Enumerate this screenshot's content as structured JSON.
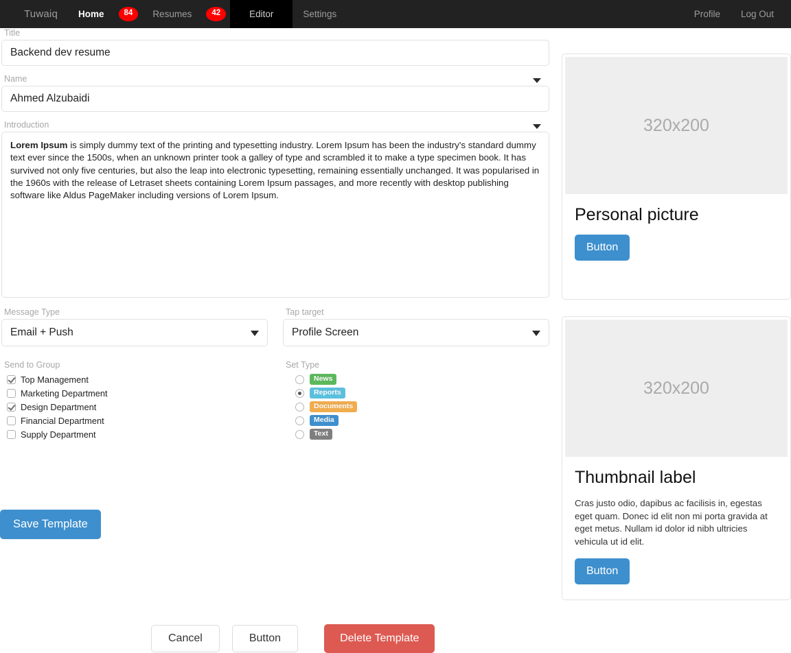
{
  "navbar": {
    "brand": "Tuwaiq",
    "items": [
      {
        "label": "Home",
        "state": "active-home"
      },
      {
        "badge": "84"
      },
      {
        "label": "Resumes",
        "state": "normal"
      },
      {
        "badge": "42"
      },
      {
        "label": "Editor",
        "state": "active-tab"
      },
      {
        "label": "Settings",
        "state": "normal"
      }
    ],
    "right": [
      {
        "label": "Profile"
      },
      {
        "label": "Log Out"
      }
    ]
  },
  "form": {
    "title": {
      "label": "Title",
      "value": "Backend dev resume"
    },
    "name": {
      "label": "Name",
      "value": "Ahmed Alzubaidi"
    },
    "introduction": {
      "label": "Introduction",
      "lead": "Lorem Ipsum",
      "body": " is simply dummy text of the printing and typesetting industry. Lorem Ipsum has been the industry's standard dummy text ever since the 1500s, when an unknown printer took a galley of type and scrambled it to make a type specimen book. It has survived not only five centuries, but also the leap into electronic typesetting, remaining essentially unchanged. It was popularised in the 1960s with the release of Letraset sheets containing Lorem Ipsum passages, and more recently with desktop publishing software like Aldus PageMaker including versions of Lorem Ipsum."
    },
    "message_type": {
      "label": "Message Type",
      "value": "Email + Push"
    },
    "tap_target": {
      "label": "Tap target",
      "value": "Profile Screen"
    },
    "send_to_group": {
      "label": "Send to Group",
      "options": [
        {
          "label": "Top Management",
          "checked": true
        },
        {
          "label": "Marketing Department",
          "checked": false
        },
        {
          "label": "Design Department",
          "checked": true
        },
        {
          "label": "Financial Department",
          "checked": false
        },
        {
          "label": "Supply Department",
          "checked": false
        }
      ]
    },
    "set_type": {
      "label": "Set Type",
      "options": [
        {
          "label": "News",
          "color": "#5cb85c",
          "selected": false
        },
        {
          "label": "Reports",
          "color": "#5bc0de",
          "selected": true
        },
        {
          "label": "Documents",
          "color": "#f0ad4e",
          "selected": false
        },
        {
          "label": "Media",
          "color": "#3e8fcd",
          "selected": false
        },
        {
          "label": "Text",
          "color": "#7f7f7f",
          "selected": false
        }
      ]
    },
    "save_button": "Save Template"
  },
  "footer": {
    "cancel": "Cancel",
    "button": "Button",
    "delete": "Delete Template"
  },
  "cards": [
    {
      "placeholder": "320x200",
      "title": "Personal picture",
      "text": "",
      "button": "Button"
    },
    {
      "placeholder": "320x200",
      "title": "Thumbnail label",
      "text": "Cras justo odio, dapibus ac facilisis in, egestas eget quam. Donec id elit non mi porta gravida at eget metus. Nullam id dolor id nibh ultricies vehicula ut id elit.",
      "button": "Button"
    }
  ],
  "colors": {
    "navbar_bg": "#222222",
    "active_tab_bg": "#000000",
    "badge_red": "#ff0000",
    "primary_blue": "#3e8fcd",
    "danger_red": "#dd5a52"
  }
}
